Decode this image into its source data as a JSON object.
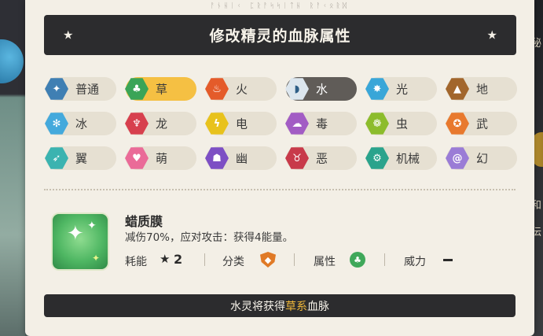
{
  "header": {
    "runes": "ᚨᚾᚺᛁᚲ ᛈᚱᚨᛋᛋᛁᛏᚺ ᚱᚨᚲᛟᚱᛞ",
    "title": "修改精灵的血脉属性"
  },
  "types": [
    {
      "label": "普通",
      "color": "#3f7fb3",
      "icon": "normal-icon",
      "glyph": "✦",
      "state": "normal"
    },
    {
      "label": "草",
      "color": "#3aa457",
      "icon": "grass-icon",
      "glyph": "♣",
      "state": "selected"
    },
    {
      "label": "火",
      "color": "#e45b2a",
      "icon": "fire-icon",
      "glyph": "♨",
      "state": "normal"
    },
    {
      "label": "水",
      "color": "#2f8fd6",
      "icon": "water-icon",
      "glyph": "◗",
      "state": "current"
    },
    {
      "label": "光",
      "color": "#39a6d8",
      "icon": "light-icon",
      "glyph": "✸",
      "state": "normal"
    },
    {
      "label": "地",
      "color": "#a2662c",
      "icon": "ground-icon",
      "glyph": "▲",
      "state": "normal"
    },
    {
      "label": "冰",
      "color": "#44a9dc",
      "icon": "ice-icon",
      "glyph": "✻",
      "state": "normal"
    },
    {
      "label": "龙",
      "color": "#d7404e",
      "icon": "dragon-icon",
      "glyph": "♆",
      "state": "normal"
    },
    {
      "label": "电",
      "color": "#e8c21c",
      "icon": "electric-icon",
      "glyph": "ϟ",
      "state": "normal"
    },
    {
      "label": "毒",
      "color": "#a25cc4",
      "icon": "poison-icon",
      "glyph": "☁",
      "state": "normal"
    },
    {
      "label": "虫",
      "color": "#8cbc2c",
      "icon": "bug-icon",
      "glyph": "❁",
      "state": "normal"
    },
    {
      "label": "武",
      "color": "#e8792e",
      "icon": "fighting-icon",
      "glyph": "✪",
      "state": "normal"
    },
    {
      "label": "翼",
      "color": "#3bb3b0",
      "icon": "wing-icon",
      "glyph": "➶",
      "state": "normal"
    },
    {
      "label": "萌",
      "color": "#ea6b98",
      "icon": "cute-icon",
      "glyph": "♥",
      "state": "normal"
    },
    {
      "label": "幽",
      "color": "#7d4fc4",
      "icon": "ghost-icon",
      "glyph": "☗",
      "state": "normal"
    },
    {
      "label": "恶",
      "color": "#c83a4a",
      "icon": "evil-icon",
      "glyph": "♉",
      "state": "normal"
    },
    {
      "label": "机械",
      "color": "#2aa38c",
      "icon": "mechanical-icon",
      "glyph": "⚙",
      "state": "normal"
    },
    {
      "label": "幻",
      "color": "#9a7cd6",
      "icon": "illusion-icon",
      "glyph": "@",
      "state": "normal"
    }
  ],
  "skill": {
    "name": "蜡质膜",
    "description": "减伤70%，应对攻击：获得4能量。",
    "cost_label": "耗能",
    "cost_value": "2",
    "category_label": "分类",
    "category_icon": "defense-shield-icon",
    "attribute_label": "属性",
    "attribute_icon": "grass-icon",
    "power_label": "威力"
  },
  "result": {
    "prefix": "水灵将获得",
    "highlight": "草系",
    "suffix": "血脉"
  },
  "background": {
    "right_text_1": "秘",
    "right_text_2": "和",
    "right_text_3": "伝"
  }
}
